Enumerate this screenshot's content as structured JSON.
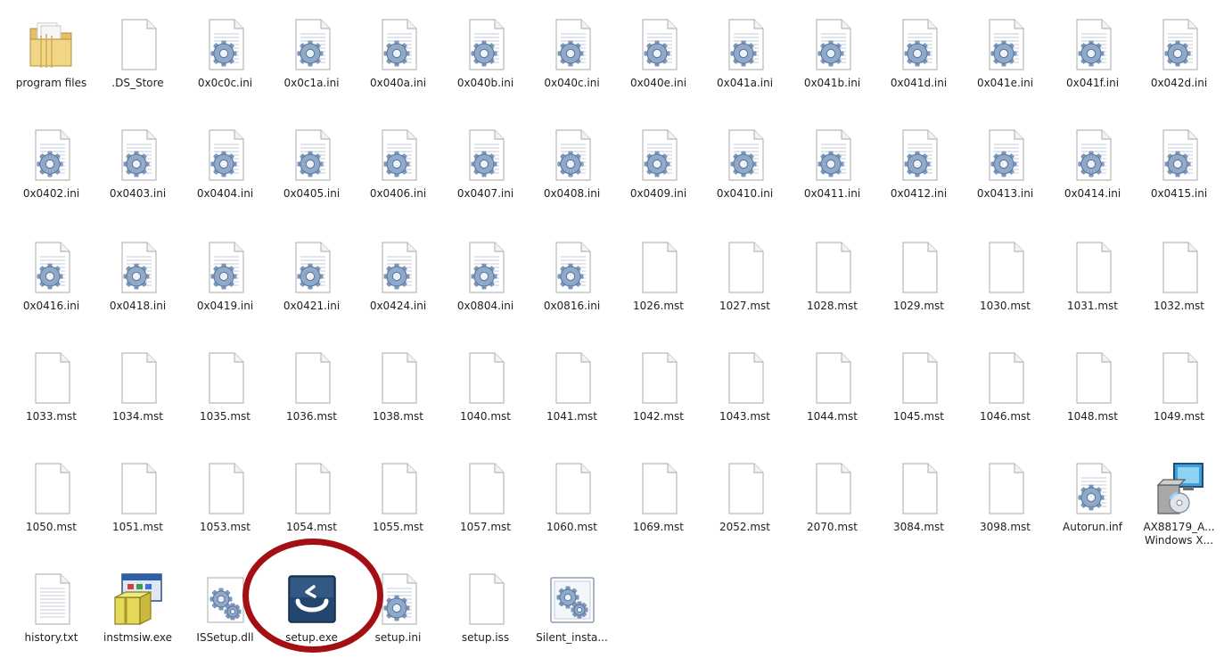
{
  "files": [
    {
      "name": "program files",
      "type": "folder"
    },
    {
      "name": ".DS_Store",
      "type": "blank"
    },
    {
      "name": "0x0c0c.ini",
      "type": "config"
    },
    {
      "name": "0x0c1a.ini",
      "type": "config"
    },
    {
      "name": "0x040a.ini",
      "type": "config"
    },
    {
      "name": "0x040b.ini",
      "type": "config"
    },
    {
      "name": "0x040c.ini",
      "type": "config"
    },
    {
      "name": "0x040e.ini",
      "type": "config"
    },
    {
      "name": "0x041a.ini",
      "type": "config"
    },
    {
      "name": "0x041b.ini",
      "type": "config"
    },
    {
      "name": "0x041d.ini",
      "type": "config"
    },
    {
      "name": "0x041e.ini",
      "type": "config"
    },
    {
      "name": "0x041f.ini",
      "type": "config"
    },
    {
      "name": "0x042d.ini",
      "type": "config"
    },
    {
      "name": "0x0402.ini",
      "type": "config"
    },
    {
      "name": "0x0403.ini",
      "type": "config"
    },
    {
      "name": "0x0404.ini",
      "type": "config"
    },
    {
      "name": "0x0405.ini",
      "type": "config"
    },
    {
      "name": "0x0406.ini",
      "type": "config"
    },
    {
      "name": "0x0407.ini",
      "type": "config"
    },
    {
      "name": "0x0408.ini",
      "type": "config"
    },
    {
      "name": "0x0409.ini",
      "type": "config"
    },
    {
      "name": "0x0410.ini",
      "type": "config"
    },
    {
      "name": "0x0411.ini",
      "type": "config"
    },
    {
      "name": "0x0412.ini",
      "type": "config"
    },
    {
      "name": "0x0413.ini",
      "type": "config"
    },
    {
      "name": "0x0414.ini",
      "type": "config"
    },
    {
      "name": "0x0415.ini",
      "type": "config"
    },
    {
      "name": "0x0416.ini",
      "type": "config"
    },
    {
      "name": "0x0418.ini",
      "type": "config"
    },
    {
      "name": "0x0419.ini",
      "type": "config"
    },
    {
      "name": "0x0421.ini",
      "type": "config"
    },
    {
      "name": "0x0424.ini",
      "type": "config"
    },
    {
      "name": "0x0804.ini",
      "type": "config"
    },
    {
      "name": "0x0816.ini",
      "type": "config"
    },
    {
      "name": "1026.mst",
      "type": "blank"
    },
    {
      "name": "1027.mst",
      "type": "blank"
    },
    {
      "name": "1028.mst",
      "type": "blank"
    },
    {
      "name": "1029.mst",
      "type": "blank"
    },
    {
      "name": "1030.mst",
      "type": "blank"
    },
    {
      "name": "1031.mst",
      "type": "blank"
    },
    {
      "name": "1032.mst",
      "type": "blank"
    },
    {
      "name": "1033.mst",
      "type": "blank"
    },
    {
      "name": "1034.mst",
      "type": "blank"
    },
    {
      "name": "1035.mst",
      "type": "blank"
    },
    {
      "name": "1036.mst",
      "type": "blank"
    },
    {
      "name": "1038.mst",
      "type": "blank"
    },
    {
      "name": "1040.mst",
      "type": "blank"
    },
    {
      "name": "1041.mst",
      "type": "blank"
    },
    {
      "name": "1042.mst",
      "type": "blank"
    },
    {
      "name": "1043.mst",
      "type": "blank"
    },
    {
      "name": "1044.mst",
      "type": "blank"
    },
    {
      "name": "1045.mst",
      "type": "blank"
    },
    {
      "name": "1046.mst",
      "type": "blank"
    },
    {
      "name": "1048.mst",
      "type": "blank"
    },
    {
      "name": "1049.mst",
      "type": "blank"
    },
    {
      "name": "1050.mst",
      "type": "blank"
    },
    {
      "name": "1051.mst",
      "type": "blank"
    },
    {
      "name": "1053.mst",
      "type": "blank"
    },
    {
      "name": "1054.mst",
      "type": "blank"
    },
    {
      "name": "1055.mst",
      "type": "blank"
    },
    {
      "name": "1057.mst",
      "type": "blank"
    },
    {
      "name": "1060.mst",
      "type": "blank"
    },
    {
      "name": "1069.mst",
      "type": "blank"
    },
    {
      "name": "2052.mst",
      "type": "blank"
    },
    {
      "name": "2070.mst",
      "type": "blank"
    },
    {
      "name": "3084.mst",
      "type": "blank"
    },
    {
      "name": "3098.mst",
      "type": "blank"
    },
    {
      "name": "Autorun.inf",
      "type": "config"
    },
    {
      "name": "AX88179_A...\nWindows X...",
      "type": "installer"
    },
    {
      "name": "history.txt",
      "type": "text"
    },
    {
      "name": "instmsiw.exe",
      "type": "msi"
    },
    {
      "name": "ISSetup.dll",
      "type": "dll"
    },
    {
      "name": "setup.exe",
      "type": "setup"
    },
    {
      "name": "setup.ini",
      "type": "config"
    },
    {
      "name": "setup.iss",
      "type": "blank"
    },
    {
      "name": "Silent_insta...",
      "type": "silent"
    }
  ],
  "highlight": {
    "target": "setup.exe",
    "color": "#a30f12"
  }
}
